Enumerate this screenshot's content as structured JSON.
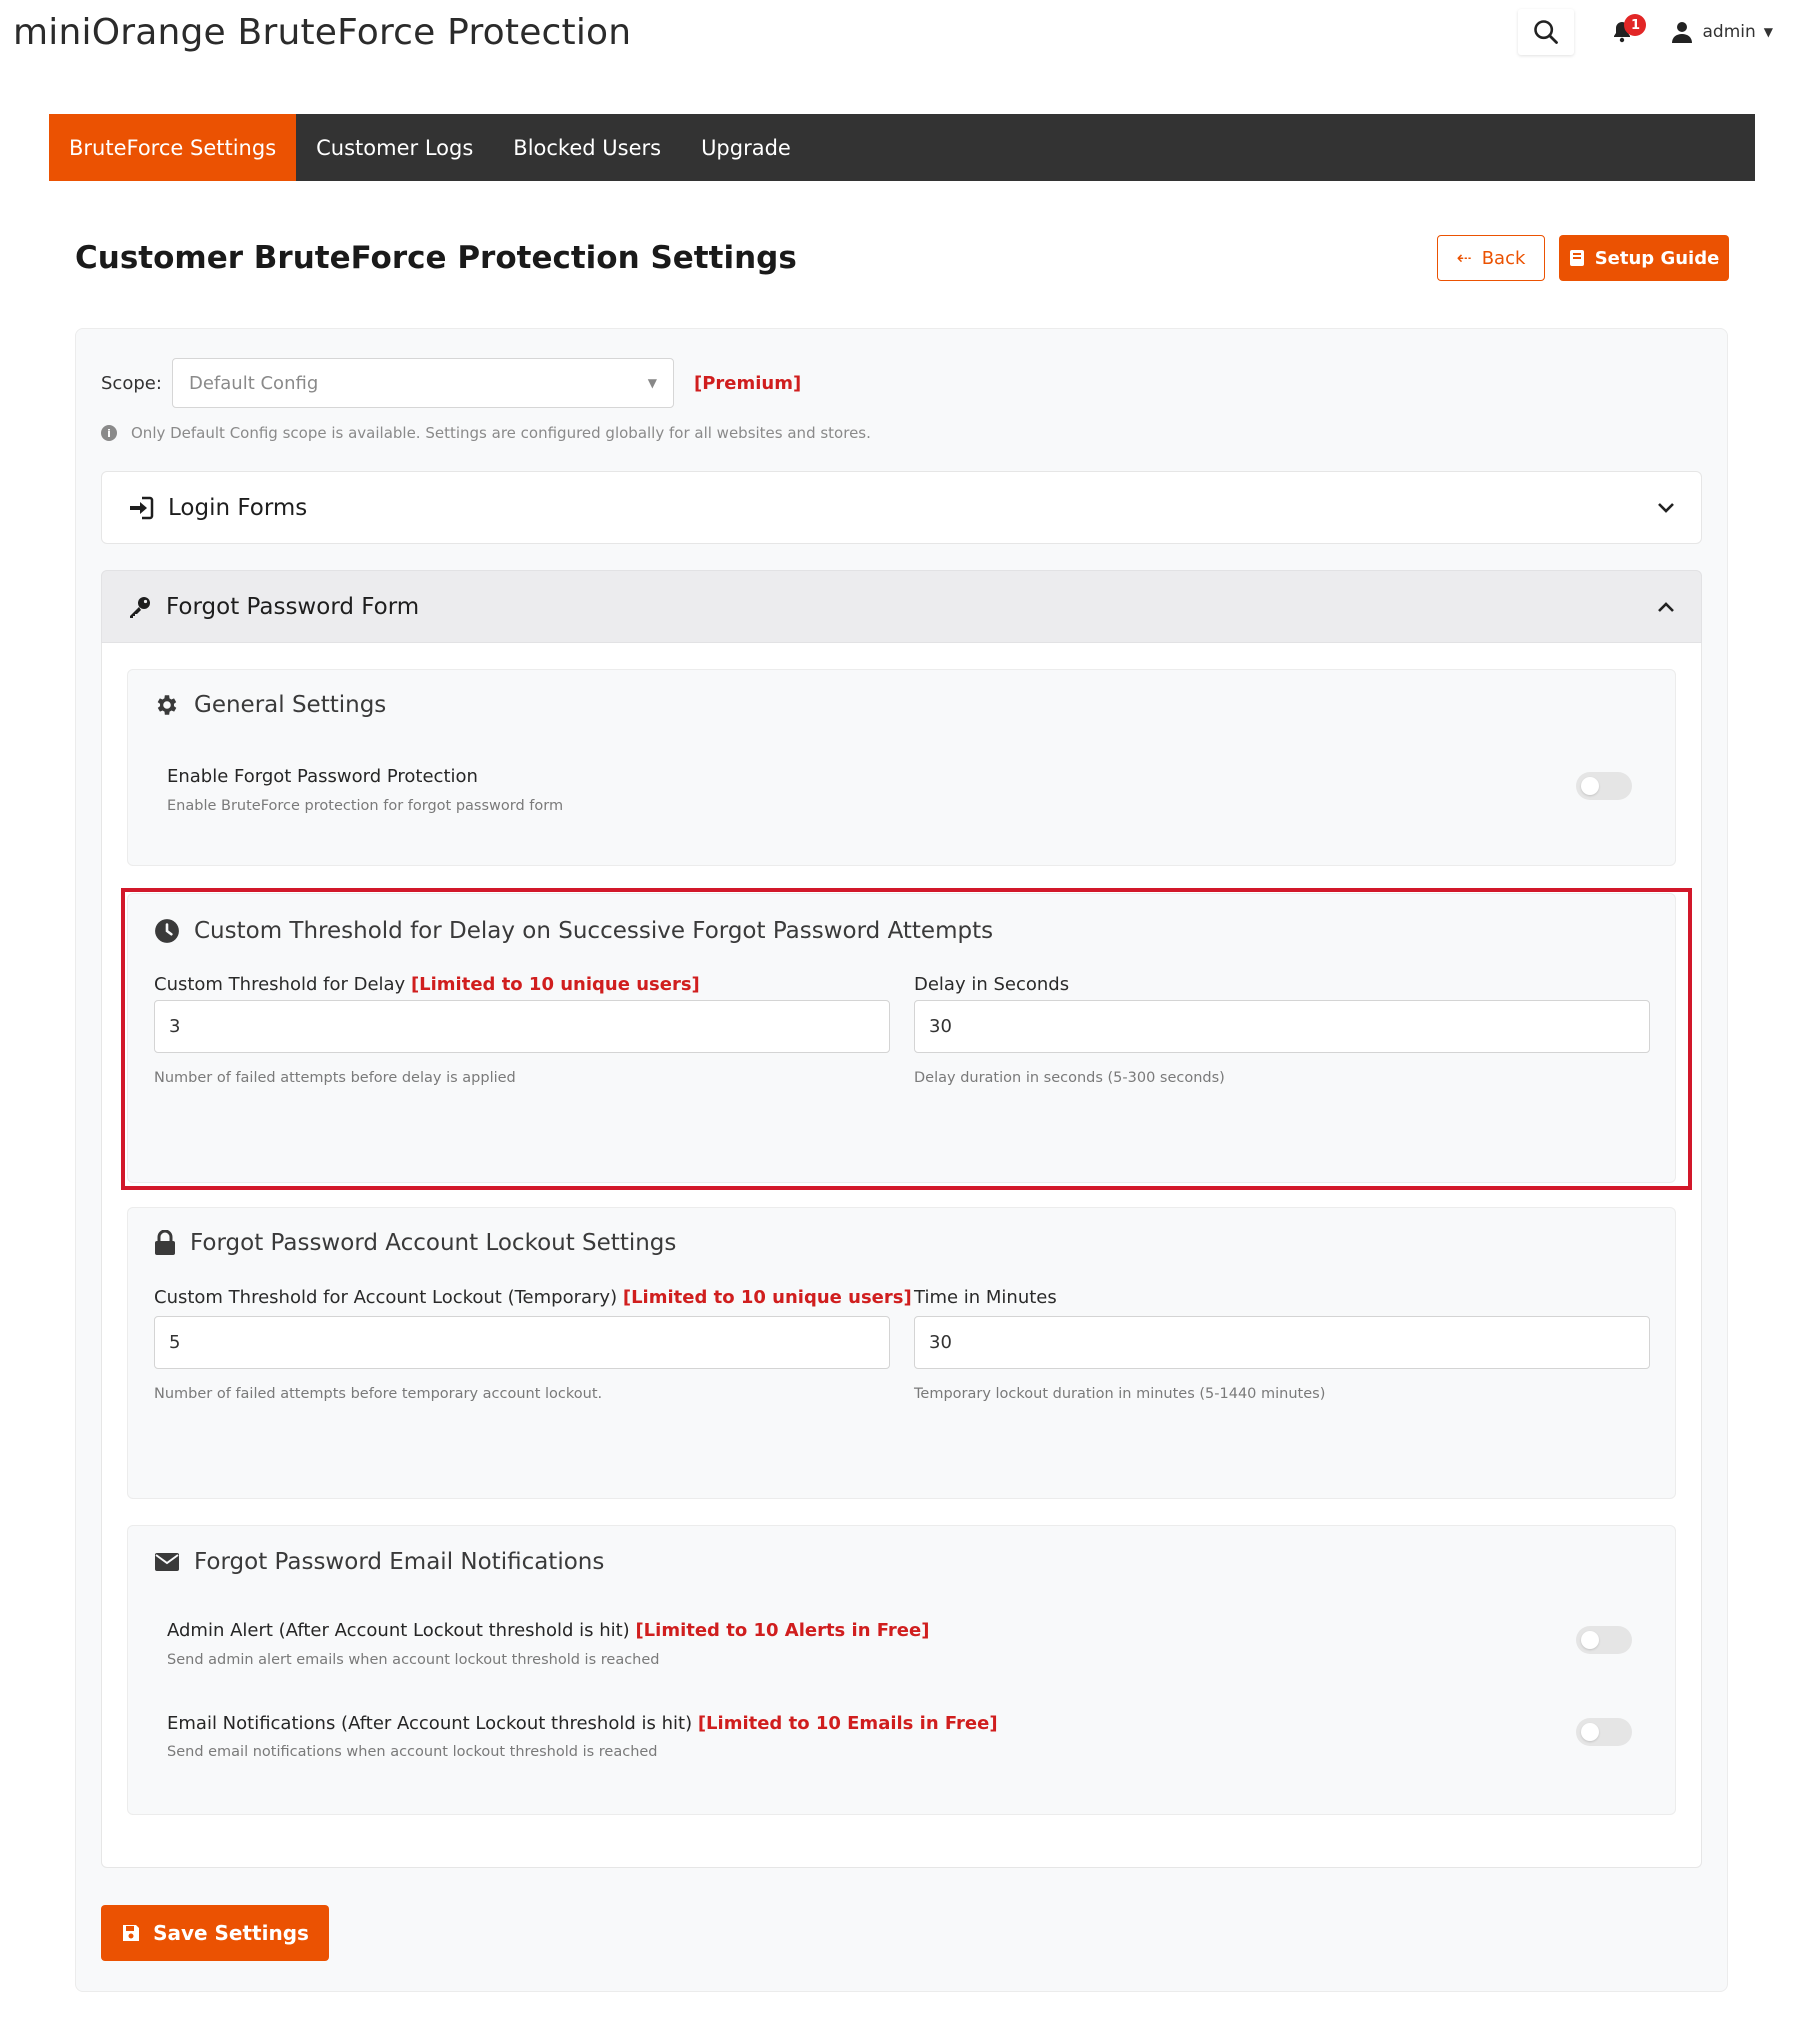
{
  "app": {
    "title": "miniOrange BruteForce Protection"
  },
  "header": {
    "notification_count": "1",
    "user_name": "admin"
  },
  "nav": {
    "items": [
      "BruteForce Settings",
      "Customer Logs",
      "Blocked Users",
      "Upgrade"
    ],
    "active_index": 0
  },
  "page": {
    "title": "Customer BruteForce Protection Settings",
    "back_label": "Back",
    "guide_label": "Setup Guide"
  },
  "scope": {
    "label": "Scope:",
    "value": "Default Config",
    "premium": "[Premium]",
    "note": "Only Default Config scope is available. Settings are configured globally for all websites and stores."
  },
  "accordions": {
    "login": {
      "title": "Login Forms"
    },
    "forgot": {
      "title": "Forgot Password Form"
    }
  },
  "general": {
    "title": "General Settings",
    "enable_label": "Enable Forgot Password Protection",
    "enable_help": "Enable BruteForce protection for forgot password form",
    "enable_on": false
  },
  "delay": {
    "title": "Custom Threshold for Delay on Successive Forgot Password Attempts",
    "threshold_label": "Custom Threshold for Delay",
    "threshold_limit": "[Limited to 10 unique users]",
    "threshold_value": "3",
    "threshold_help": "Number of failed attempts before delay is applied",
    "seconds_label": "Delay in Seconds",
    "seconds_value": "30",
    "seconds_help": "Delay duration in seconds (5-300 seconds)"
  },
  "lockout": {
    "title": "Forgot Password Account Lockout Settings",
    "threshold_label": "Custom Threshold for Account Lockout (Temporary)",
    "threshold_limit": "[Limited to 10 unique users]",
    "threshold_value": "5",
    "threshold_help": "Number of failed attempts before temporary account lockout.",
    "minutes_label": "Time in Minutes",
    "minutes_value": "30",
    "minutes_help": "Temporary lockout duration in minutes (5-1440 minutes)"
  },
  "email": {
    "title": "Forgot Password Email Notifications",
    "admin_label": "Admin Alert (After Account Lockout threshold is hit)",
    "admin_limit": "[Limited to 10 Alerts in Free]",
    "admin_help": "Send admin alert emails when account lockout threshold is reached",
    "admin_on": false,
    "notify_label": "Email Notifications (After Account Lockout threshold is hit)",
    "notify_limit": "[Limited to 10 Emails in Free]",
    "notify_help": "Send email notifications when account lockout threshold is reached",
    "notify_on": false
  },
  "save": {
    "label": "Save Settings"
  },
  "colors": {
    "accent": "#eb5202",
    "nav_bg": "#333333",
    "limit_red": "#d01e1e",
    "highlight_red": "#d2182a"
  },
  "icons": [
    "search-icon",
    "bell-icon",
    "user-icon",
    "arrow-left-icon",
    "book-icon",
    "info-icon",
    "sign-in-icon",
    "key-icon",
    "chevron-down-icon",
    "chevron-up-icon",
    "gear-icon",
    "clock-icon",
    "lock-icon",
    "envelope-icon",
    "save-icon"
  ]
}
